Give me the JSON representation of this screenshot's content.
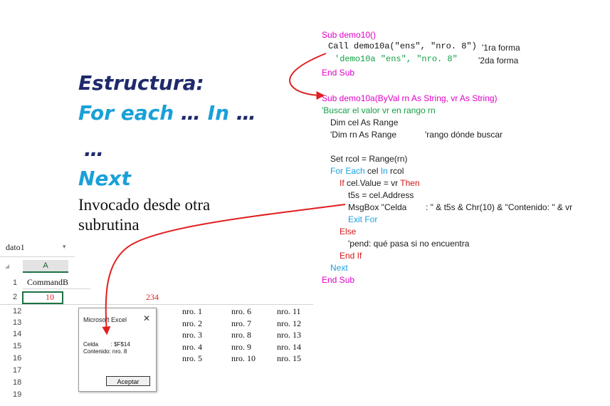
{
  "slide": {
    "title_line1": "Estructura:",
    "title_line2_a": "For each",
    "title_line2_b": "…",
    "title_line2_c": "In",
    "title_line2_d": "…",
    "title_line3": "…",
    "title_line4": "Next",
    "subtitle_line1": "Invocado desde otra",
    "subtitle_line2": "subrutina"
  },
  "code_top": {
    "l1": "Sub demo10()",
    "l2": "Call demo10a(\"ens\", \"nro. 8\")",
    "l2_comment": "'1ra forma",
    "l3": "'demo10a \"ens\", \"nro. 8\"",
    "l3_comment": "'2da forma",
    "l4": "End Sub"
  },
  "code_main": {
    "l1": "Sub demo10a(ByVal rn As String, vr As String)",
    "l2": "'Buscar el valor vr en rango rn",
    "l3": "Dim cel As Range",
    "l4a": "'Dim rn As Range",
    "l4b": "'rango dónde buscar",
    "l5": "Set rcol = Range(rn)",
    "l6_kw1": "For Each",
    "l6_mid": " cel ",
    "l6_kw2": "In",
    "l6_end": " rcol",
    "l7_kw1": "If",
    "l7_mid": " cel.Value = vr ",
    "l7_kw2": "Then",
    "l8": "t5s = cel.Address",
    "l9": "MsgBox \"Celda        : \" & t5s & Chr(10) & \"Contenido: \" & vr",
    "l10": "Exit For",
    "l11": "Else",
    "l12": "'pend: qué pasa si no encuentra",
    "l13": "End If",
    "l14": "Next",
    "l15": "End Sub"
  },
  "excel": {
    "namebox": "dato1",
    "col_a": "A",
    "cell_a1": "CommandB",
    "cell_a2": "10",
    "cell_c2": "234",
    "row_numbers": [
      "1",
      "2",
      "12",
      "13",
      "14",
      "15",
      "16",
      "17",
      "18",
      "19"
    ],
    "col1": [
      "nro. 1",
      "nro. 2",
      "nro. 3",
      "nro. 4",
      "nro. 5"
    ],
    "col2": [
      "nro. 6",
      "nro. 7",
      "nro. 8",
      "nro. 9",
      "nro. 10"
    ],
    "col3": [
      "nro. 11",
      "nro. 12",
      "nro. 13",
      "nro. 14",
      "nro. 15"
    ]
  },
  "dialog": {
    "title": "Microsoft Excel",
    "line1": "Celda        : $F$14",
    "line2": "Contenido: nro. 8",
    "button": "Aceptar"
  },
  "colors": {
    "accent_red": "#e02020",
    "title_dark": "#1f2a6b",
    "title_blue": "#1aa0d8",
    "code_magenta": "#e000c8",
    "code_green": "#14a045",
    "code_cyan": "#1aa0e0"
  }
}
